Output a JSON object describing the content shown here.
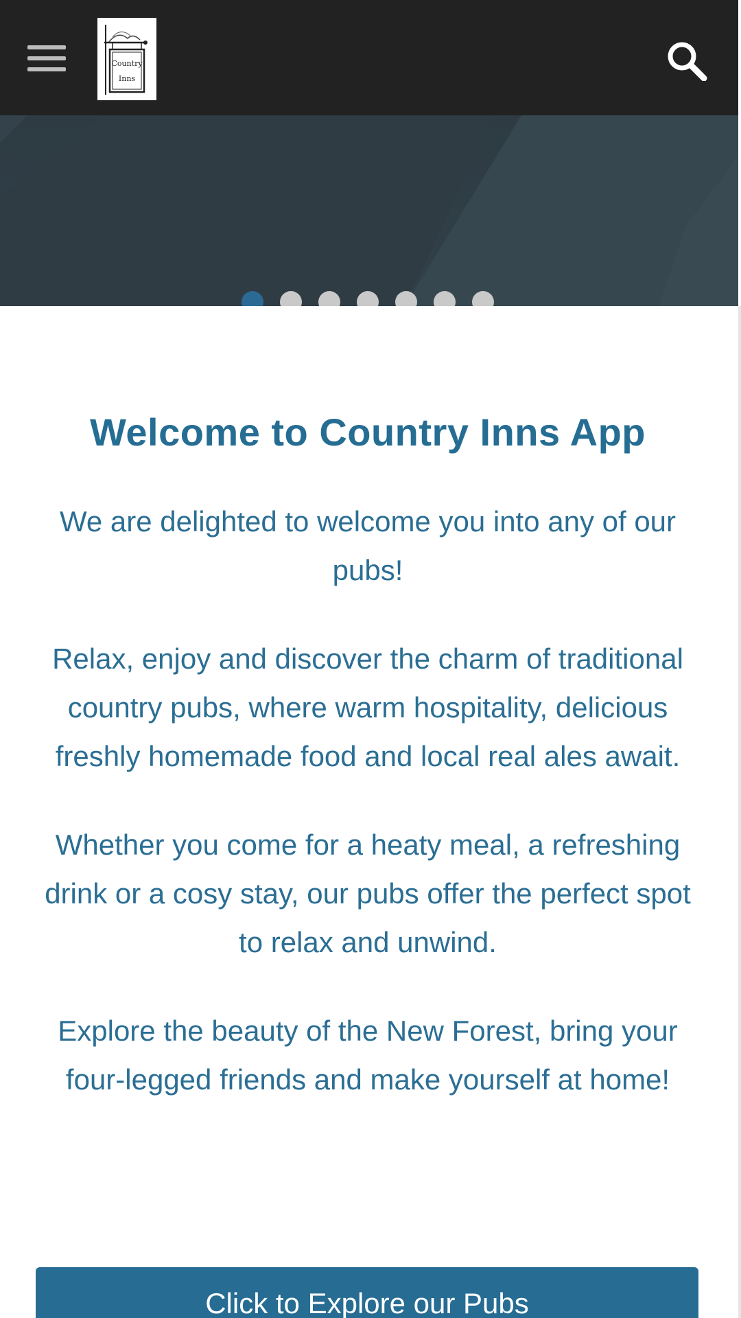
{
  "header": {
    "menu_icon": "hamburger-menu-icon",
    "logo_text": "Country Inns",
    "search_icon": "search-icon",
    "colors": {
      "bar": "#222222",
      "icon": "#bdbdbd"
    }
  },
  "carousel": {
    "slide_count": 7,
    "active_index": 0,
    "colors": {
      "active": "#2a6a94",
      "inactive": "#c9c9c9"
    }
  },
  "main": {
    "title": "Welcome to Country Inns App",
    "paragraphs": [
      "We are delighted to welcome you into any of our pubs!",
      "Relax, enjoy and discover the charm of traditional country pubs, where warm hospitality, delicious freshly homemade food and local real ales await.",
      "Whether you come for a heaty meal, a refreshing drink or a cosy stay, our pubs offer the perfect spot to relax and unwind.",
      "Explore the beauty of the New Forest, bring your four-legged friends and make yourself at home!"
    ],
    "cta_label": "Click to Explore our Pubs",
    "colors": {
      "text": "#2b6e94",
      "button": "#266c93"
    }
  }
}
